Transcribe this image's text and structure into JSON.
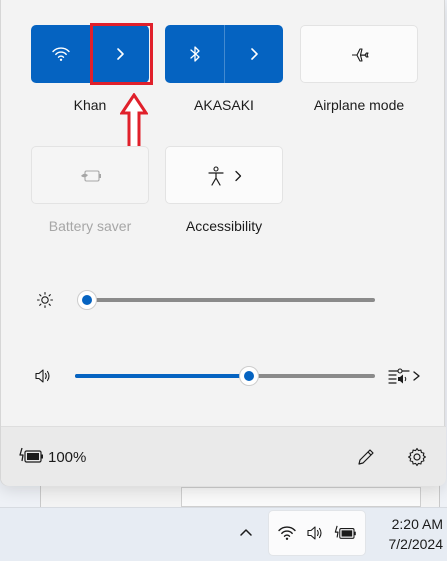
{
  "tiles": {
    "wifi": {
      "label": "Khan",
      "state": "on"
    },
    "bluetooth": {
      "label": "AKASAKI",
      "state": "on"
    },
    "airplane": {
      "label": "Airplane mode",
      "state": "off"
    },
    "battery_saver": {
      "label": "Battery saver",
      "state": "disabled"
    },
    "accessibility": {
      "label": "Accessibility",
      "state": "off"
    }
  },
  "sliders": {
    "brightness": {
      "level_fraction": 0.0
    },
    "volume": {
      "level_fraction": 0.58
    }
  },
  "footer": {
    "battery_percent": "100%"
  },
  "taskbar": {
    "time": "2:20 AM",
    "date": "7/2/2024"
  },
  "icons": {
    "wifi": "wifi-icon",
    "bluetooth": "bluetooth-icon",
    "airplane": "airplane-icon",
    "battery_saver": "battery-saver-icon",
    "accessibility": "accessibility-icon",
    "brightness": "sun-icon",
    "volume": "speaker-icon",
    "audio_output": "audio-output-icon",
    "edit": "pencil-icon",
    "settings": "gear-icon",
    "overflow": "chevron-up-icon"
  },
  "colors": {
    "accent": "#0563c1",
    "annotation": "#e0202b"
  }
}
